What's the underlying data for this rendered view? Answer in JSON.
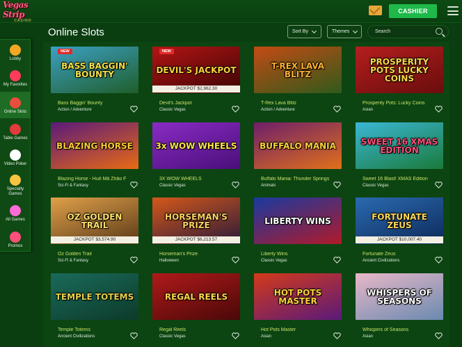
{
  "app": {
    "logo_line1": "Vegas Strip",
    "logo_line2": "CASINO",
    "cashier_label": "CASHIER"
  },
  "sidebar": {
    "items": [
      {
        "label": "Lobby",
        "icon": "lobby-icon",
        "color": "#f5a623"
      },
      {
        "label": "My Favorites",
        "icon": "heart-icon",
        "color": "#ff3b5c"
      },
      {
        "label": "Online Slots",
        "icon": "slot-machine-icon",
        "color": "#e94e3a",
        "active": true
      },
      {
        "label": "Table Games",
        "icon": "poker-chip-icon",
        "color": "#e23b3b"
      },
      {
        "label": "Video Poker",
        "icon": "playing-card-icon",
        "color": "#ffffff"
      },
      {
        "label": "Specialty Games",
        "icon": "specialty-icon",
        "color": "#f5c542"
      },
      {
        "label": "All Games",
        "icon": "all-games-icon",
        "color": "#ff6bd6"
      },
      {
        "label": "Promos",
        "icon": "gift-icon",
        "color": "#ff4f7a"
      }
    ]
  },
  "main": {
    "title": "Online Slots",
    "sort_label": "Sort By",
    "themes_label": "Themes",
    "search_placeholder": "Search"
  },
  "games": [
    {
      "name": "Bass Baggin' Bounty",
      "category": "Action / Adventure",
      "badge": "NEW",
      "jackpot": "",
      "thumb_text": "BASS BAGGIN' BOUNTY",
      "bg": "#3ca0c4",
      "bg2": "#1f5e2a",
      "fg": "#f2e14a"
    },
    {
      "name": "Devil's Jackpot",
      "category": "Classic Vegas",
      "badge": "NEW",
      "jackpot": "JACKPOT $2,962.30",
      "thumb_text": "DEVIL'S JACKPOT",
      "bg": "#b31414",
      "bg2": "#3c0505",
      "fg": "#ffd23a"
    },
    {
      "name": "T-Rex Lava Blitz",
      "category": "Action / Adventure",
      "badge": "",
      "jackpot": "",
      "thumb_text": "T-REX LAVA BLITZ",
      "bg": "#c44b14",
      "bg2": "#2f5a1a",
      "fg": "#ffb02e"
    },
    {
      "name": "Prosperity Pots: Lucky Coins",
      "category": "Asian",
      "badge": "",
      "jackpot": "",
      "thumb_text": "PROSPERITY POTS LUCKY COINS",
      "bg": "#b51e1e",
      "bg2": "#6a0d0d",
      "fg": "#ffd54a"
    },
    {
      "name": "Blazing Horse - Huŏ Mă Zhāo F",
      "category": "Sci-Fi & Fantasy",
      "badge": "",
      "jackpot": "",
      "thumb_text": "BLAZING HORSE",
      "bg": "#5b1a7a",
      "bg2": "#e86a14",
      "fg": "#ffcc33"
    },
    {
      "name": "3X WOW WHEELS",
      "category": "Classic Vegas",
      "badge": "",
      "jackpot": "",
      "thumb_text": "3x WOW WHEELS",
      "bg": "#8a2bc4",
      "bg2": "#4a0f7a",
      "fg": "#ffe24a"
    },
    {
      "name": "Buffalo Mania: Thunder Springs",
      "category": "Animals",
      "badge": "",
      "jackpot": "",
      "thumb_text": "BUFFALO MANIA",
      "bg": "#6e1f6a",
      "bg2": "#e0701a",
      "fg": "#ffd13a"
    },
    {
      "name": "Sweet 16 Blast! XMAS Edition",
      "category": "Classic Vegas",
      "badge": "",
      "jackpot": "",
      "thumb_text": "SWEET 16 XMAS EDITION",
      "bg": "#3bb7d6",
      "bg2": "#1a7a3a",
      "fg": "#ff4f7a"
    },
    {
      "name": "Oz Golden Trail",
      "category": "Sci-Fi & Fantasy",
      "badge": "",
      "jackpot": "JACKPOT $3,574.90",
      "thumb_text": "OZ GOLDEN TRAIL",
      "bg": "#e0a04a",
      "bg2": "#5a3a18",
      "fg": "#ffe06a"
    },
    {
      "name": "Horseman's Prize",
      "category": "Halloween",
      "badge": "",
      "jackpot": "JACKPOT $6,213.57",
      "thumb_text": "HORSEMAN'S PRIZE",
      "bg": "#d4581a",
      "bg2": "#2a1a3a",
      "fg": "#ffd060"
    },
    {
      "name": "Liberty Wins",
      "category": "Classic Vegas",
      "badge": "",
      "jackpot": "",
      "thumb_text": "LIBERTY WINS",
      "bg": "#1a3aa0",
      "bg2": "#b01a2a",
      "fg": "#ffffff"
    },
    {
      "name": "Fortunate Zeus",
      "category": "Ancient Civilizations",
      "badge": "",
      "jackpot": "JACKPOT $10,007.40",
      "thumb_text": "FORTUNATE ZEUS",
      "bg": "#2a6ab0",
      "bg2": "#0e2a5a",
      "fg": "#ffd95a"
    },
    {
      "name": "Temple Totems",
      "category": "Ancient Civilizations",
      "badge": "",
      "jackpot": "",
      "thumb_text": "TEMPLE TOTEMS",
      "bg": "#1a6a5a",
      "bg2": "#0d3a2a",
      "fg": "#e6d14a"
    },
    {
      "name": "Regal Reels",
      "category": "Classic Vegas",
      "badge": "",
      "jackpot": "",
      "thumb_text": "REGAL REELS",
      "bg": "#b01a1a",
      "bg2": "#4a0808",
      "fg": "#ffd54a"
    },
    {
      "name": "Hot Pots Master",
      "category": "Asian",
      "badge": "",
      "jackpot": "",
      "thumb_text": "HOT POTS MASTER",
      "bg": "#d43a1a",
      "bg2": "#5a1a7a",
      "fg": "#ffd23a"
    },
    {
      "name": "Whispers of Seasons",
      "category": "Asian",
      "badge": "",
      "jackpot": "",
      "thumb_text": "WHISPERS OF SEASONS",
      "bg": "#e8b8c8",
      "bg2": "#6a8ab0",
      "fg": "#ffffff"
    }
  ]
}
